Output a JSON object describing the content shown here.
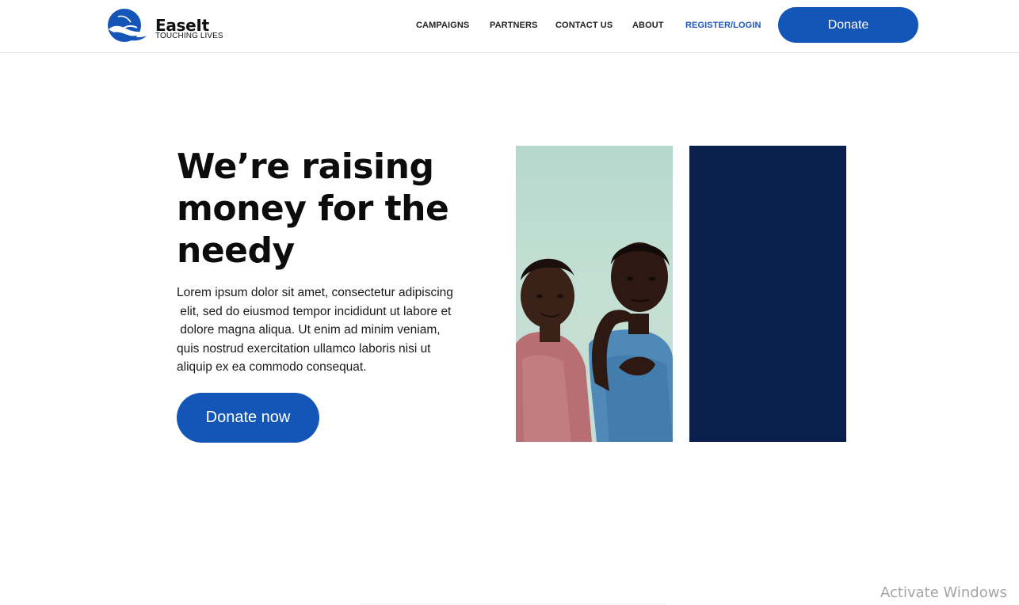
{
  "brand": {
    "name": "EaseIt",
    "tagline": "TOUCHING LIVES",
    "logo_icon": "hand-dove-icon"
  },
  "nav": {
    "items": [
      {
        "label": "CAMPAIGNS"
      },
      {
        "label": "PARTNERS"
      },
      {
        "label": "CONTACT US"
      },
      {
        "label": "ABOUT"
      },
      {
        "label": "REGISTER/LOGIN"
      }
    ],
    "donate_label": "Donate"
  },
  "hero": {
    "title": "We’re raising money for the needy",
    "body_lines": [
      "Lorem ipsum dolor sit amet, consectetur adipiscing",
      " elit, sed do eiusmod tempor incididunt ut labore et",
      " dolore magna aliqua. Ut enim ad minim veniam,",
      "quis nostrud exercitation ullamco laboris nisi ut",
      "aliquip ex ea commodo consequat."
    ],
    "cta_label": "Donate now"
  },
  "system": {
    "watermark": "Activate Windows"
  },
  "colors": {
    "primary": "#1356b8",
    "navy_panel": "#0a1f4b",
    "photo_sky": "#b6d8cd",
    "register_link": "#1f57b8"
  }
}
